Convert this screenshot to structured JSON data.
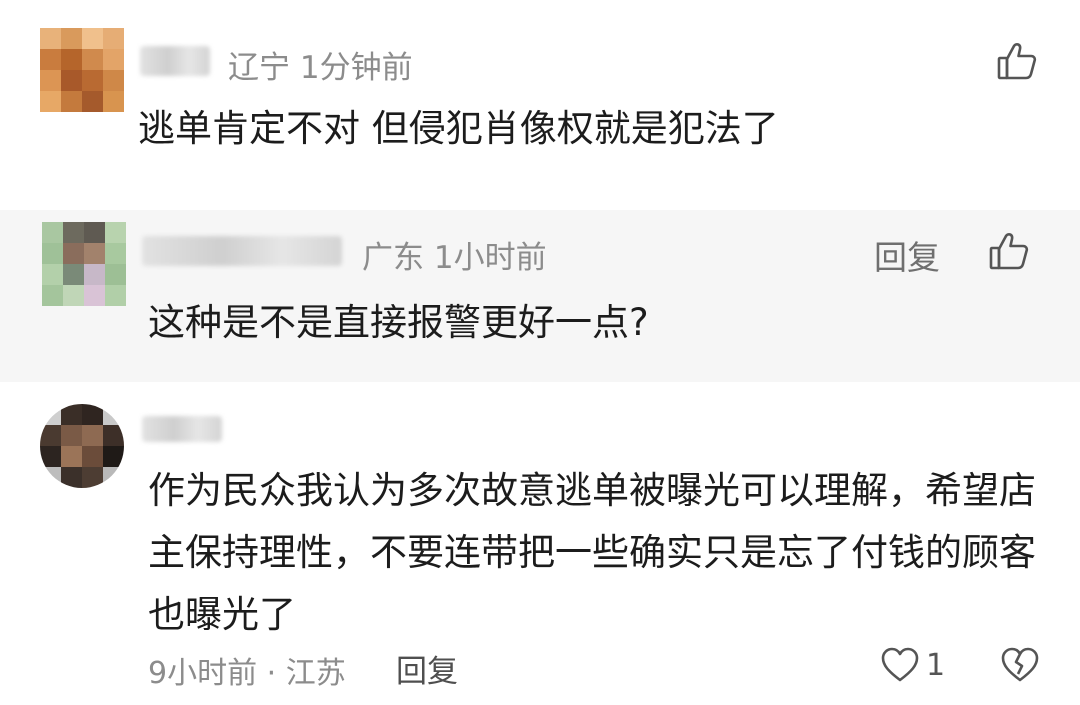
{
  "comments": [
    {
      "region_time": "辽宁 1分钟前",
      "text": "逃单肯定不对 但侵犯肖像权就是犯法了",
      "like_icon": "thumbs-up-icon"
    },
    {
      "region_time": "广东 1小时前",
      "reply_label": "回复",
      "text": "这种是不是直接报警更好一点?",
      "like_icon": "thumbs-up-icon"
    },
    {
      "text_lines": [
        "作为民众我认为多次故意逃单被曝光可以理解，希望店",
        "主保持理性，不要连带把一些确实只是忘了付钱的顾客",
        "也曝光了"
      ],
      "time_region": "9小时前 · 江苏",
      "reply_label": "回复",
      "like_count": "1",
      "like_icon": "heart-icon",
      "dislike_icon": "broken-heart-icon"
    }
  ]
}
